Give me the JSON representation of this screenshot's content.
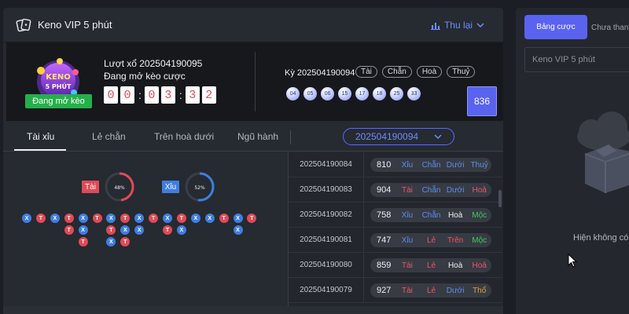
{
  "header": {
    "title": "Keno VIP 5 phút",
    "history_label": "Thu lại"
  },
  "info": {
    "logo_text_top": "KENO",
    "logo_text_bottom": "5 PHÚT",
    "status_button": "Đang mở kèo",
    "draw_line": "Lượt xổ 202504190095",
    "open_line": "Đang mở kèo cược",
    "timer_digits": [
      "0",
      "0",
      "0",
      "3",
      "3",
      "2"
    ],
    "last_draw_label": "Kỳ 202504190094",
    "last_draw_tags": [
      "Tài",
      "Chẵn",
      "Hoà",
      "Thuỷ"
    ],
    "last_draw_balls": [
      "04",
      "05",
      "06",
      "15",
      "17",
      "18",
      "25",
      "33"
    ],
    "last_draw_total": "836"
  },
  "tabs": {
    "items": [
      "Tài xỉu",
      "Lẻ chẵn",
      "Trên hoà dưới",
      "Ngũ hành"
    ],
    "selected_period": "202504190094"
  },
  "stats": {
    "tai_label": "Tài",
    "tai_percent_text": "48%",
    "tai_percent": 48,
    "xiu_label": "Xỉu",
    "xiu_percent_text": "52%",
    "xiu_percent": 52,
    "road_columns": [
      [
        "X"
      ],
      [
        "T"
      ],
      [
        "X"
      ],
      [
        "T",
        "T"
      ],
      [
        "X",
        "X",
        "T"
      ],
      [
        "T"
      ],
      [
        "X",
        "T",
        "X"
      ],
      [
        "T",
        "X",
        "T"
      ],
      [
        "X",
        "X"
      ],
      [
        "T"
      ],
      [
        "X",
        "T"
      ],
      [
        "T",
        "X"
      ],
      [
        "X"
      ],
      [
        "X"
      ],
      [
        "T"
      ],
      [
        "X",
        "X"
      ],
      [
        "T"
      ]
    ]
  },
  "results": [
    {
      "period": "202504190084",
      "sum": "810",
      "labels": [
        "Xỉu",
        "Chẵn",
        "Dưới",
        "Thuỷ"
      ],
      "colors": [
        "blue",
        "blue",
        "blue",
        "blue"
      ]
    },
    {
      "period": "202504190083",
      "sum": "904",
      "labels": [
        "Tài",
        "Chẵn",
        "Dưới",
        "Hoả"
      ],
      "colors": [
        "red",
        "blue",
        "blue",
        "red"
      ]
    },
    {
      "period": "202504190082",
      "sum": "758",
      "labels": [
        "Xỉu",
        "Chẵn",
        "Hoà",
        "Mộc"
      ],
      "colors": [
        "blue",
        "blue",
        "white",
        "green"
      ]
    },
    {
      "period": "202504190081",
      "sum": "747",
      "labels": [
        "Xỉu",
        "Lẻ",
        "Trên",
        "Mộc"
      ],
      "colors": [
        "blue",
        "red",
        "red",
        "green"
      ]
    },
    {
      "period": "202504190080",
      "sum": "859",
      "labels": [
        "Tài",
        "Lẻ",
        "Hoà",
        "Hoả"
      ],
      "colors": [
        "red",
        "red",
        "white",
        "red"
      ]
    },
    {
      "period": "202504190079",
      "sum": "927",
      "labels": [
        "Tài",
        "Lẻ",
        "Dưới",
        "Thổ"
      ],
      "colors": [
        "red",
        "red",
        "blue",
        "gold"
      ]
    }
  ],
  "side": {
    "tab_active": "Bảng cược",
    "tab_other": "Chưa thanh",
    "input_value": "Keno VIP 5 phút",
    "empty_text": "Hiện không có"
  },
  "colors": {
    "accent": "#5a63f0",
    "tai": "#e04a57",
    "xiu": "#3f7ee0",
    "open_green": "#25b04a"
  }
}
